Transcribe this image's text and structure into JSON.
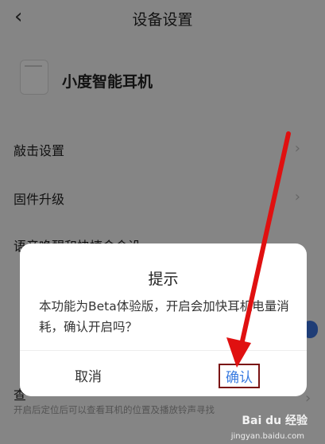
{
  "screen": {
    "title": "设备设置",
    "back_icon": "‹",
    "device_name": "小度智能耳机",
    "rows": [
      {
        "label": "敲击设置",
        "chevron": "›"
      },
      {
        "label": "固件升级",
        "chevron": "›"
      }
    ],
    "partial_row_1": "语音唤醒和快捷命令设",
    "partial_row_2": "查",
    "partial_row_2_sub": "开启后定位后可以查看耳机的位置及播放铃声寻找"
  },
  "dialog": {
    "title": "提示",
    "message": "本功能为Beta体验版，开启会加快耳机电量消耗，确认开启吗？",
    "cancel": "取消",
    "confirm": "确认"
  },
  "annotation": {
    "arrow_color": "#e01010",
    "highlight_color": "#7a1414"
  },
  "watermark": {
    "brand": "Bai du 经验",
    "url": "jingyan.baidu.com"
  }
}
